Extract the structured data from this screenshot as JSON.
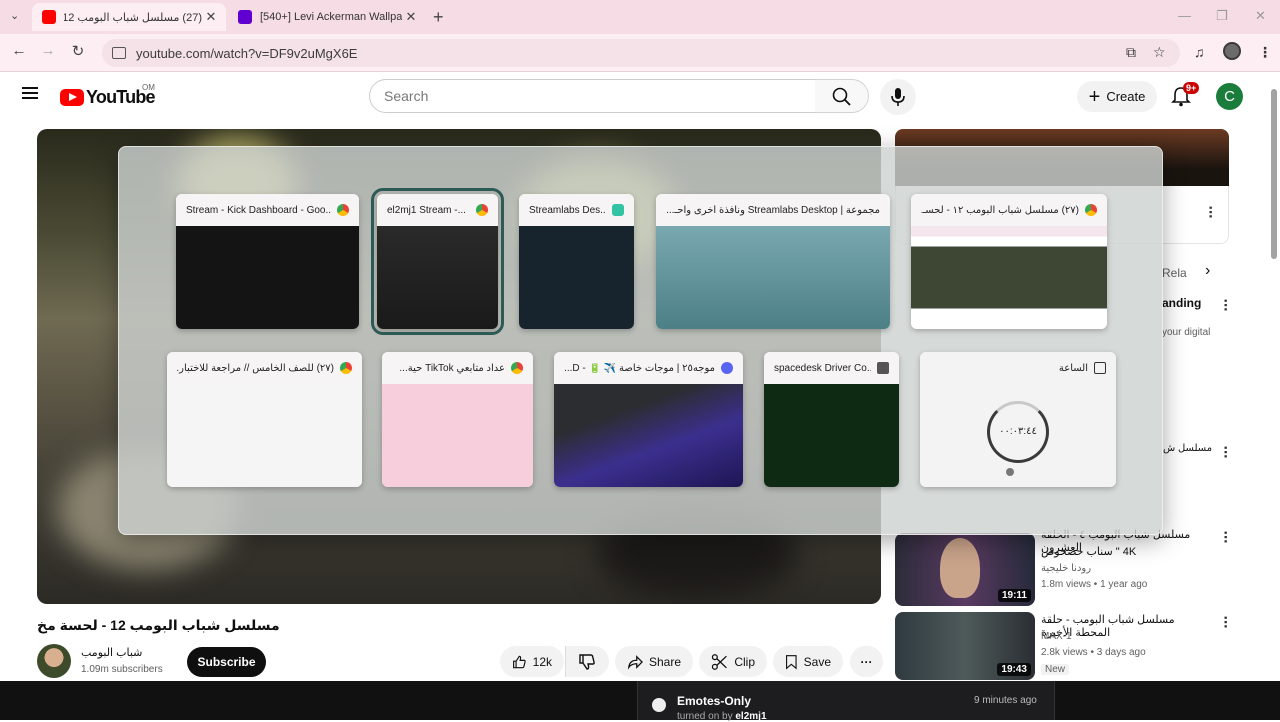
{
  "browser": {
    "tabs": [
      {
        "title": "(27) مسلسل شباب البومب 12 -",
        "active": true
      },
      {
        "title": "[540+] Levi Ackerman Wallpape",
        "active": false
      }
    ],
    "url": "youtube.com/watch?v=DF9v2uMgX6E",
    "new_tab": "+",
    "tab_close": "✕",
    "win_min": "—",
    "win_max": "❐",
    "win_close": "✕"
  },
  "youtube": {
    "logo_text": "YouTube",
    "country_code": "OM",
    "search_placeholder": "Search",
    "create_label": "Create",
    "notif_badge": "9+",
    "avatar_letter": "C"
  },
  "video": {
    "title": "مسلسل شباب البومب 12 - لحسة مخ",
    "channel_name": "شباب البومب",
    "subscribers": "1.09m subscribers",
    "subscribe_label": "Subscribe",
    "like_count": "12k",
    "share_label": "Share",
    "clip_label": "Clip",
    "save_label": "Save"
  },
  "sidebar": {
    "partial_item_1": {
      "title": "anding",
      "sub": "your digital"
    },
    "partial_item_2": {
      "title": "مسلسل ش"
    },
    "chip_next": "Rela",
    "items": [
      {
        "title": "مسلسل شباب البومب ٤ - الحلقة العشرون",
        "title2": "4K \" سناب حصحوص",
        "channel": "رودنا خليجية",
        "meta": "1.8m views • 1 year ago",
        "duration": "19:11"
      },
      {
        "title": "مسلسل شباب البومب - حلقة المحطة الأخيرة",
        "channel": "MAX-1",
        "meta": "2.8k views • 3 days ago",
        "badge": "New",
        "duration": "19:43"
      }
    ]
  },
  "task_view": {
    "row1": [
      {
        "title": "Stream - Kick Dashboard - Goo...",
        "icon": "chrome"
      },
      {
        "title": "el2mj1 Stream -...",
        "icon": "chrome"
      },
      {
        "title": "Streamlabs Des...",
        "icon": "streamlabs"
      },
      {
        "title": "مجموعة | Streamlabs Desktop ونافذة أخرى واحـ...",
        "icon": "none"
      },
      {
        "title": "(٢٧) مسلسل شباب البومب ١٢ - لحسـ...",
        "icon": "chrome"
      }
    ],
    "row2": [
      {
        "title": "(٢٧) للصف الخامس // مراجعة للاختبار...",
        "icon": "chrome"
      },
      {
        "title": "عداد متابعي TikTok حية...",
        "icon": "chrome"
      },
      {
        "title": "موجه٢٥ | موجات خاصة ✈️ 🔋 - D...",
        "icon": "discord"
      },
      {
        "title": "spacedesk Driver Co...",
        "icon": "spacedesk"
      },
      {
        "title": "الساعة",
        "icon": "clock"
      }
    ],
    "clock_time": "٠٠:٠٣:٤٤"
  },
  "chat": {
    "title": "Emotes-Only",
    "time": "9 minutes ago",
    "turned_on_by_prefix": "turned on by ",
    "user": "el2mj1"
  },
  "colors": {
    "accent_red": "#ff0000",
    "tab_bar": "#f6dde5",
    "avatar_green": "#1b7d3c"
  }
}
